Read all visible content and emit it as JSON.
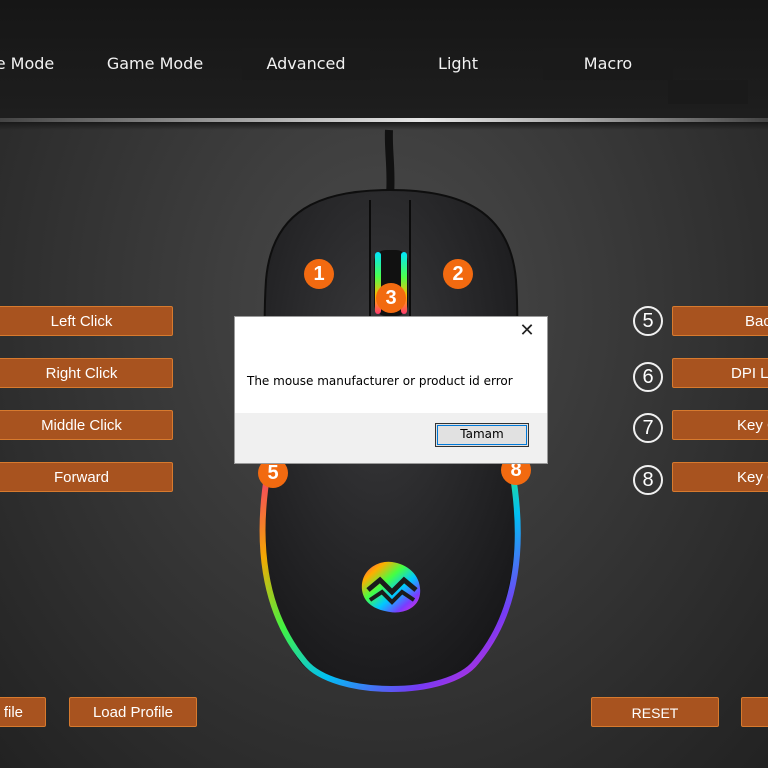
{
  "tabs": [
    {
      "label": "e Mode"
    },
    {
      "label": "Game Mode"
    },
    {
      "label": "Advanced"
    },
    {
      "label": "Light"
    },
    {
      "label": "Macro"
    }
  ],
  "left_buttons": [
    {
      "label": "Left Click"
    },
    {
      "label": "Right Click"
    },
    {
      "label": "Middle Click"
    },
    {
      "label": "Forward"
    }
  ],
  "right_buttons": [
    {
      "num": "5",
      "label": "Bac"
    },
    {
      "num": "6",
      "label": "DPI Lo"
    },
    {
      "num": "7",
      "label": "Key C"
    },
    {
      "num": "8",
      "label": "Key C"
    }
  ],
  "mouse_badges": [
    "1",
    "2",
    "3",
    "5",
    "8"
  ],
  "bottom": {
    "profile_partial": "file",
    "load_profile": "Load Profile",
    "reset": "RESET"
  },
  "dialog": {
    "message": "The mouse manufacturer or product id error",
    "ok_label": "Tamam",
    "close_glyph": "✕"
  },
  "colors": {
    "accent": "#f26a10",
    "button_bg": "#a8531f",
    "button_border": "#d77a2e"
  }
}
